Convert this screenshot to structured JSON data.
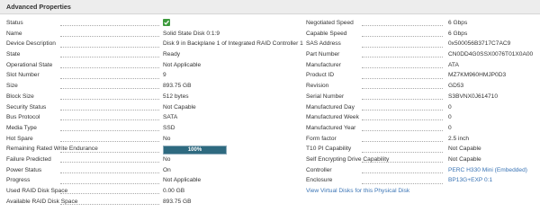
{
  "header": {
    "title": "Advanced Properties"
  },
  "left": [
    {
      "label": "Status",
      "kind": "status-icon",
      "icon": "check-icon",
      "color": "#3d9a3d"
    },
    {
      "label": "Name",
      "value": "Solid State Disk 0:1:9"
    },
    {
      "label": "Device Description",
      "value": "Disk 9 in Backplane 1 of Integrated RAID Controller 1"
    },
    {
      "label": "State",
      "value": "Ready"
    },
    {
      "label": "Operational State",
      "value": "Not Applicable"
    },
    {
      "label": "Slot Number",
      "value": "9"
    },
    {
      "label": "Size",
      "value": "893.75 GB"
    },
    {
      "label": "Block Size",
      "value": "512 bytes"
    },
    {
      "label": "Security Status",
      "value": "Not Capable"
    },
    {
      "label": "Bus Protocol",
      "value": "SATA"
    },
    {
      "label": "Media Type",
      "value": "SSD"
    },
    {
      "label": "Hot Spare",
      "value": "No"
    },
    {
      "label": "Remaining Rated Write Endurance",
      "kind": "progress",
      "value": "100%",
      "percent": 100
    },
    {
      "label": "Failure Predicted",
      "value": "No"
    },
    {
      "label": "Power Status",
      "value": "On"
    },
    {
      "label": "Progress",
      "value": "Not Applicable"
    },
    {
      "label": "Used RAID Disk Space",
      "value": "0.00 GB"
    },
    {
      "label": "Available RAID Disk Space",
      "value": "893.75 GB"
    }
  ],
  "right": [
    {
      "label": "Negotiated Speed",
      "value": "6 Gbps"
    },
    {
      "label": "Capable Speed",
      "value": "6 Gbps"
    },
    {
      "label": "SAS Address",
      "value": "0x500056B3717C7AC9"
    },
    {
      "label": "Part Number",
      "value": "CN0DD4G0SSX0076T01X0A00"
    },
    {
      "label": "Manufacturer",
      "value": "ATA"
    },
    {
      "label": "Product ID",
      "value": "MZ7KM960HMJP0D3"
    },
    {
      "label": "Revision",
      "value": "GD53"
    },
    {
      "label": "Serial Number",
      "value": "S3BVNX0J614710"
    },
    {
      "label": "Manufactured Day",
      "value": "0"
    },
    {
      "label": "Manufactured Week",
      "value": "0"
    },
    {
      "label": "Manufactured Year",
      "value": "0"
    },
    {
      "label": "Form factor",
      "value": "2.5 inch"
    },
    {
      "label": "T10 PI Capability",
      "value": "Not Capable"
    },
    {
      "label": "Self Encrypting Drive Capability",
      "value": "Not Capable"
    },
    {
      "label": "Controller",
      "value": "PERC H330 Mini (Embedded)",
      "kind": "link"
    },
    {
      "label": "Enclosure",
      "value": "BP13G+EXP 0:1",
      "kind": "link"
    },
    {
      "kind": "action-link",
      "value": "View Virtual Disks for this Physical Disk"
    }
  ],
  "colors": {
    "link": "#3a74b5",
    "progress_fill": "#2e6a80",
    "status_ok": "#3d9a3d"
  }
}
